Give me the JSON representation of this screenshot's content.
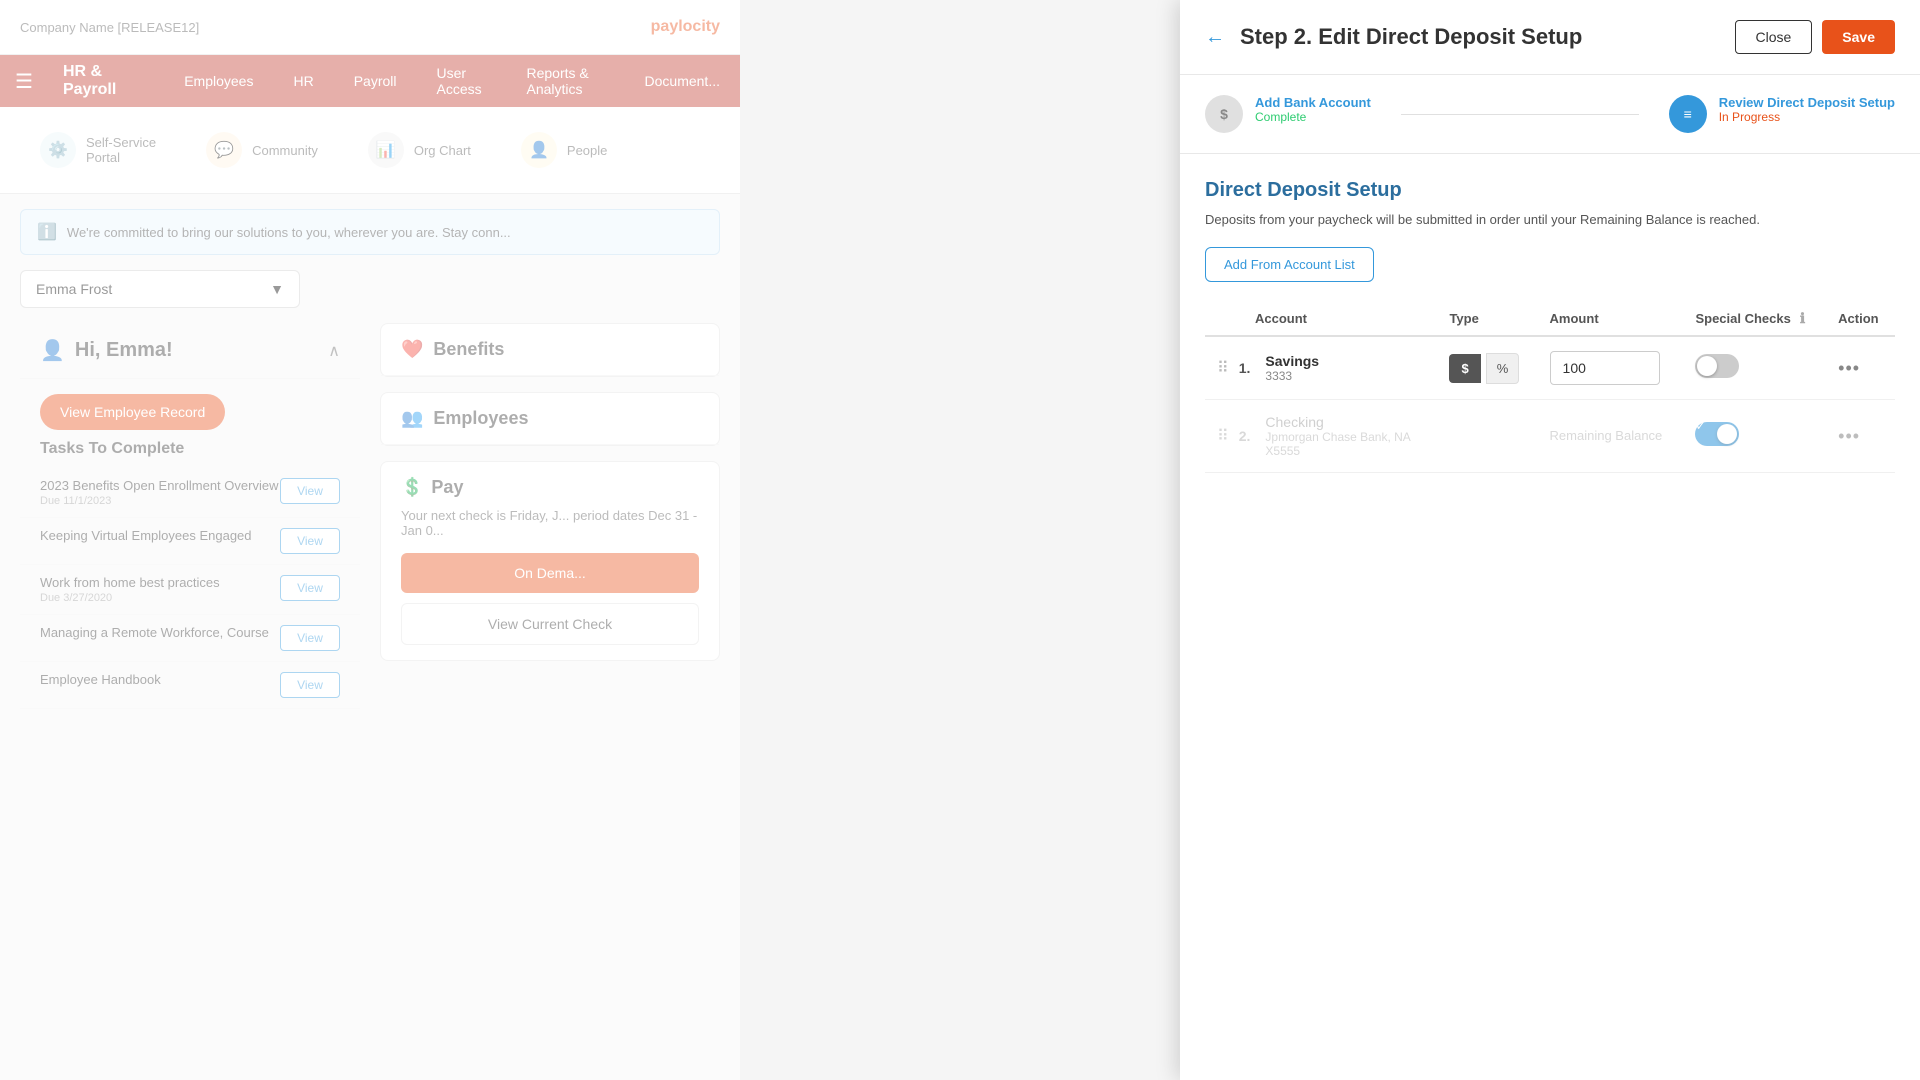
{
  "app": {
    "company_name": "Company Name [RELEASE12]",
    "logo_text": "paylocity"
  },
  "nav": {
    "brand": "HR & Payroll",
    "items": [
      "Employees",
      "HR",
      "Payroll",
      "User Access",
      "Reports & Analytics",
      "Document"
    ]
  },
  "tiles": [
    {
      "id": "self-service",
      "label": "Self-Service Portal",
      "icon": "⚙️"
    },
    {
      "id": "community",
      "label": "Community",
      "icon": "💬"
    },
    {
      "id": "org-chart",
      "label": "Org Chart",
      "icon": "📊"
    },
    {
      "id": "people",
      "label": "People",
      "icon": "👤"
    }
  ],
  "banner": {
    "text": "We're committed to bring our solutions to you, wherever you are. Stay conn..."
  },
  "employee_selector": {
    "selected": "Emma Frost"
  },
  "hi_panel": {
    "greeting": "Hi, Emma!",
    "view_record_label": "View Employee Record",
    "tasks_title": "Tasks To Complete",
    "tasks": [
      {
        "name": "2023 Benefits Open Enrollment Overview",
        "due": "Due 11/1/2023",
        "btn": "View"
      },
      {
        "name": "Keeping Virtual Employees Engaged",
        "due": "",
        "btn": "View"
      },
      {
        "name": "Work from home best practices",
        "due": "Due 3/27/2020",
        "btn": "View"
      },
      {
        "name": "Managing a Remote Workforce, Course",
        "due": "",
        "btn": "View"
      },
      {
        "name": "Employee Handbook",
        "due": "",
        "btn": "View"
      }
    ]
  },
  "benefits_panel": {
    "title": "Benefits"
  },
  "employees_panel": {
    "title": "Employees"
  },
  "pay_panel": {
    "title": "Pay",
    "description": "Your next check is Friday, J... period dates Dec 31 - Jan 0...",
    "on_demand_label": "On Dema...",
    "view_check_label": "View Current Check"
  },
  "modal": {
    "back_icon": "←",
    "title": "Step 2. Edit Direct Deposit Setup",
    "close_label": "Close",
    "save_label": "Save",
    "steps": [
      {
        "label": "Add Bank Account",
        "status": "Complete",
        "icon": "$",
        "icon_style": "gray"
      },
      {
        "label": "Review Direct Deposit Setup",
        "status": "In Progress",
        "icon": "≡",
        "icon_style": "blue"
      }
    ],
    "section_title": "Direct Deposit Setup",
    "section_desc": "Deposits from your paycheck will be submitted in order until your Remaining Balance is reached.",
    "add_account_btn": "Add From Account List",
    "table": {
      "columns": [
        "Account",
        "Type",
        "Amount",
        "Special Checks",
        "Action"
      ],
      "rows": [
        {
          "number": "1.",
          "account_name": "Savings",
          "account_id": "3333",
          "type_dollar": "$",
          "type_percent": "%",
          "amount": "100",
          "toggle": false,
          "enabled": true
        },
        {
          "number": "2.",
          "account_name": "Checking",
          "bank_name": "Jpmorgan Chase Bank, NA",
          "account_id": "X5555",
          "amount_label": "Remaining Balance",
          "toggle": true,
          "enabled": false
        }
      ]
    }
  }
}
